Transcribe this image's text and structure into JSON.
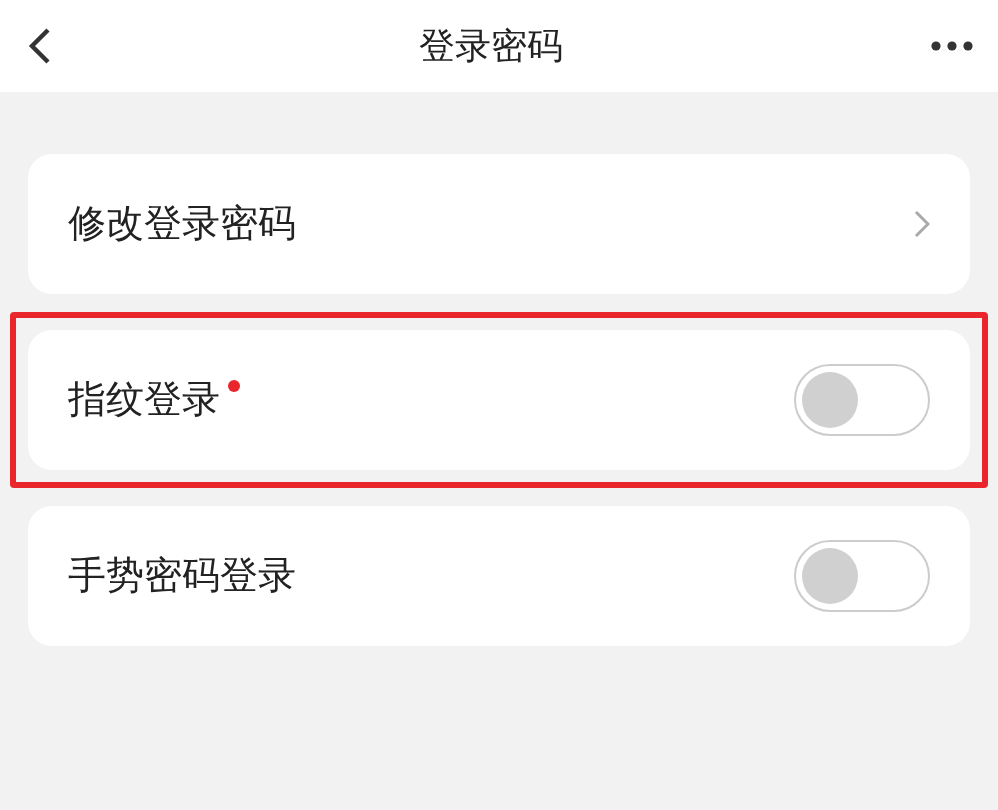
{
  "header": {
    "title": "登录密码"
  },
  "rows": [
    {
      "kind": "link",
      "label": "修改登录密码",
      "badge": false,
      "highlighted": false
    },
    {
      "kind": "toggle",
      "label": "指纹登录",
      "badge": true,
      "on": false,
      "highlighted": true
    },
    {
      "kind": "toggle",
      "label": "手势密码登录",
      "badge": false,
      "on": false,
      "highlighted": false
    }
  ]
}
